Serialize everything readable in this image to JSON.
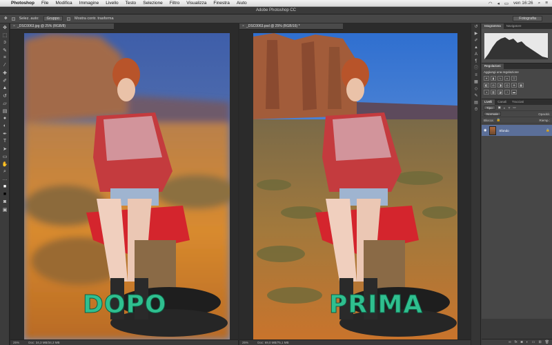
{
  "menubar": {
    "app": "Photoshop",
    "items": [
      "File",
      "Modifica",
      "Immagine",
      "Livello",
      "Testo",
      "Selezione",
      "Filtro",
      "Visualizza",
      "Finestra",
      "Aiuto"
    ],
    "clock": "ven 16:26"
  },
  "app_title": "Adobe Photoshop CC",
  "options": {
    "autoselect": "Selez. auto:",
    "group": "Gruppo",
    "transform": "Mostra contr. trasforma",
    "workspace": "Fotografia"
  },
  "doc_left": {
    "tab": "_DSC0063.jpg @ 25% (RGB/8)",
    "zoom": "25%",
    "docsize": "Doc: 34,3 MB/34,3 MB",
    "label": "DOPO"
  },
  "doc_right": {
    "tab": "_DSC0063.psd @ 25% (RGB/16) *",
    "zoom": "25%",
    "docsize": "Doc: 69,0 MB/75,1 MB",
    "label": "PRIMA"
  },
  "panels": {
    "tab_histogram": "Istogramma",
    "tab_navigator": "Navigatore",
    "adjustments_tab": "Regolazioni",
    "adjustments_title": "Aggiungi una regolazione",
    "tab_layers": "Livelli",
    "tab_channels": "Canali",
    "tab_paths": "Tracciati",
    "kind": "Tipo",
    "blend_mode": "Normale",
    "opacity": "Opacità:",
    "fill": "Riemp.:",
    "lock": "Blocca:",
    "layer_name": "Sfondo"
  }
}
